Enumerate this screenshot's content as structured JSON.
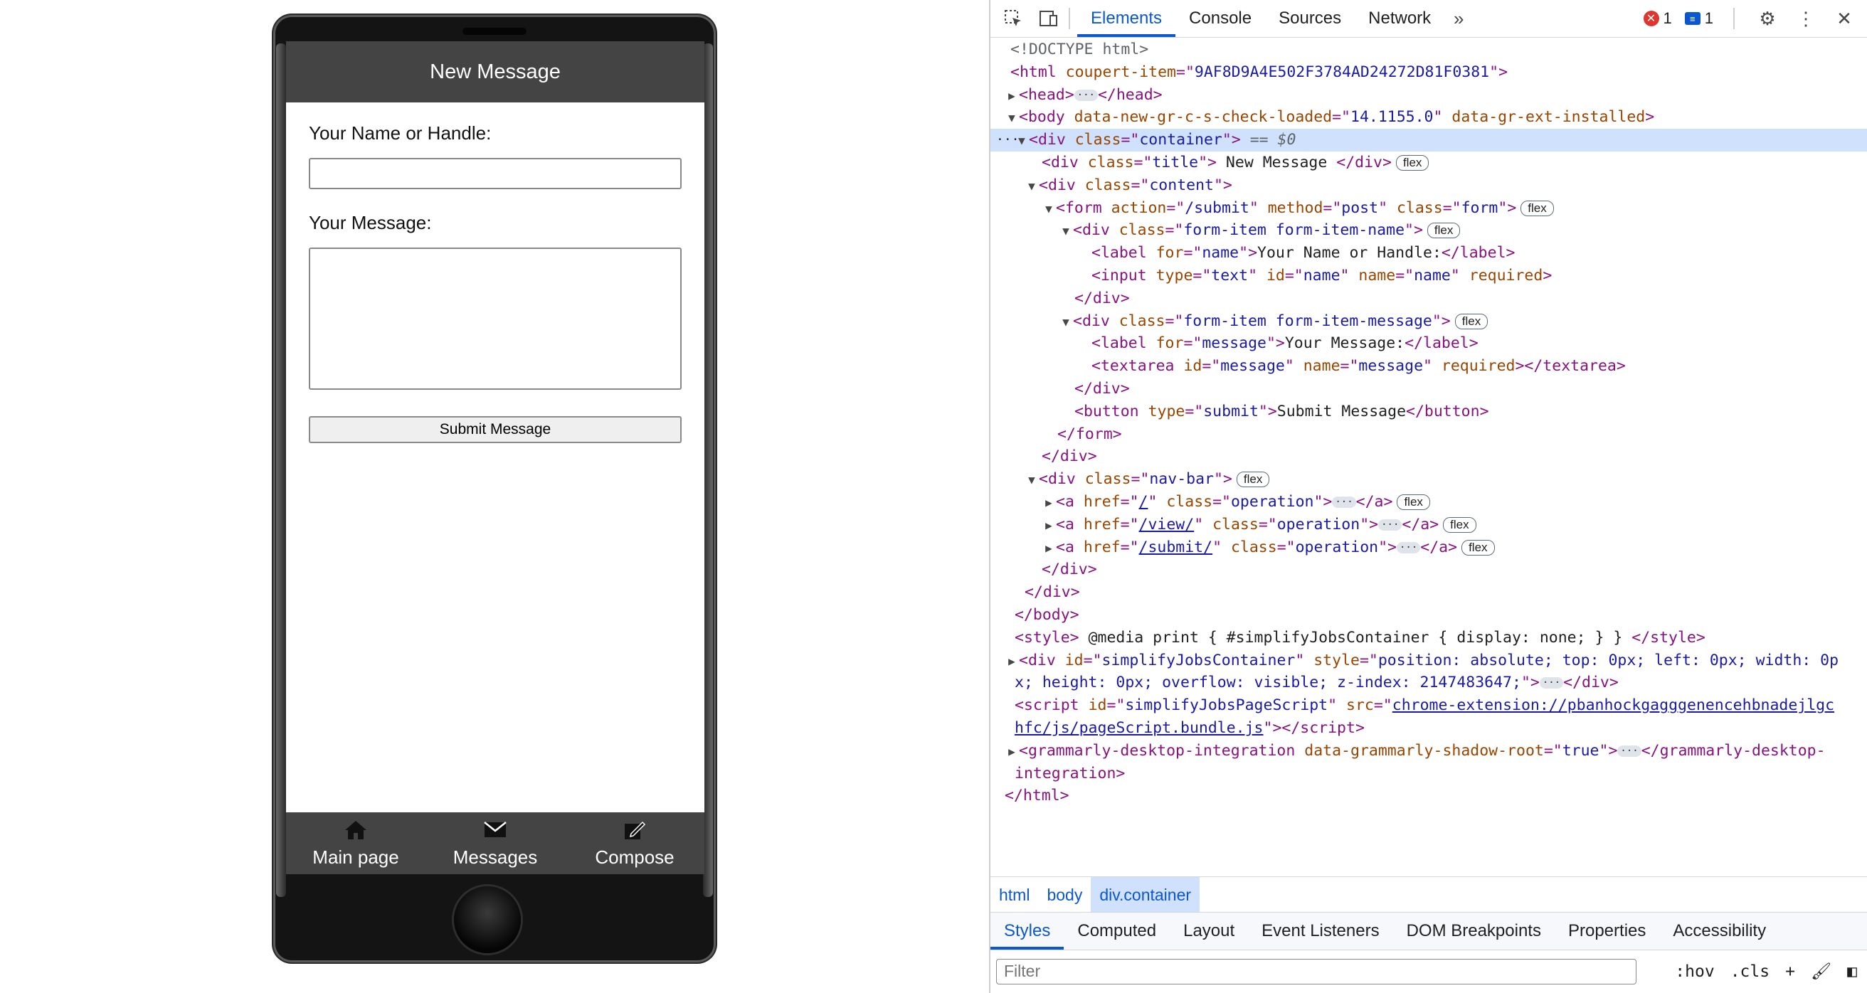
{
  "phone_app": {
    "title": "New Message",
    "name_label": "Your Name or Handle:",
    "name_value": "",
    "message_label": "Your Message:",
    "message_value": "",
    "submit_label": "Submit Message",
    "nav": [
      {
        "label": "Main page",
        "icon": "home-icon"
      },
      {
        "label": "Messages",
        "icon": "envelope-icon"
      },
      {
        "label": "Compose",
        "icon": "compose-icon"
      }
    ]
  },
  "devtools": {
    "tabs": [
      "Elements",
      "Console",
      "Sources",
      "Network"
    ],
    "active_tab": "Elements",
    "error_count": "1",
    "message_count": "1",
    "dom": {
      "doctype": "<!DOCTYPE html>",
      "html_attr_val": "9AF8D9A4E502F3784AD24272D81F0381",
      "body_attr1_val": "14.1155.0",
      "selected_suffix": "== $0",
      "title_text": " New Message ",
      "form_action": "/submit",
      "form_method": "post",
      "label_name_text": "Your Name or Handle:",
      "label_message_text": "Your Message:",
      "button_text": "Submit Message",
      "nav_hrefs": [
        "/",
        "/view/",
        "/submit/"
      ],
      "style_text": " @media print { #simplifyJobsContainer { display: none; } } ",
      "simplify_style_1": "position: absolute; top: 0px; left: 0px; width: 0p",
      "simplify_style_2": "x; height: 0px; overflow: visible; z-index: 2147483647;",
      "script_src_1": "chrome-extension://pbanhockgagggenencehbnadejlgc",
      "script_src_2": "hfc/js/pageScript.bundle.js",
      "grammarly_tail": "integration>",
      "flex_badge": "flex"
    },
    "breadcrumbs": [
      "html",
      "body",
      "div.container"
    ],
    "sub_tabs": [
      "Styles",
      "Computed",
      "Layout",
      "Event Listeners",
      "DOM Breakpoints",
      "Properties",
      "Accessibility"
    ],
    "filter_placeholder": "Filter",
    "filter_hov": ":hov",
    "filter_cls": ".cls"
  }
}
